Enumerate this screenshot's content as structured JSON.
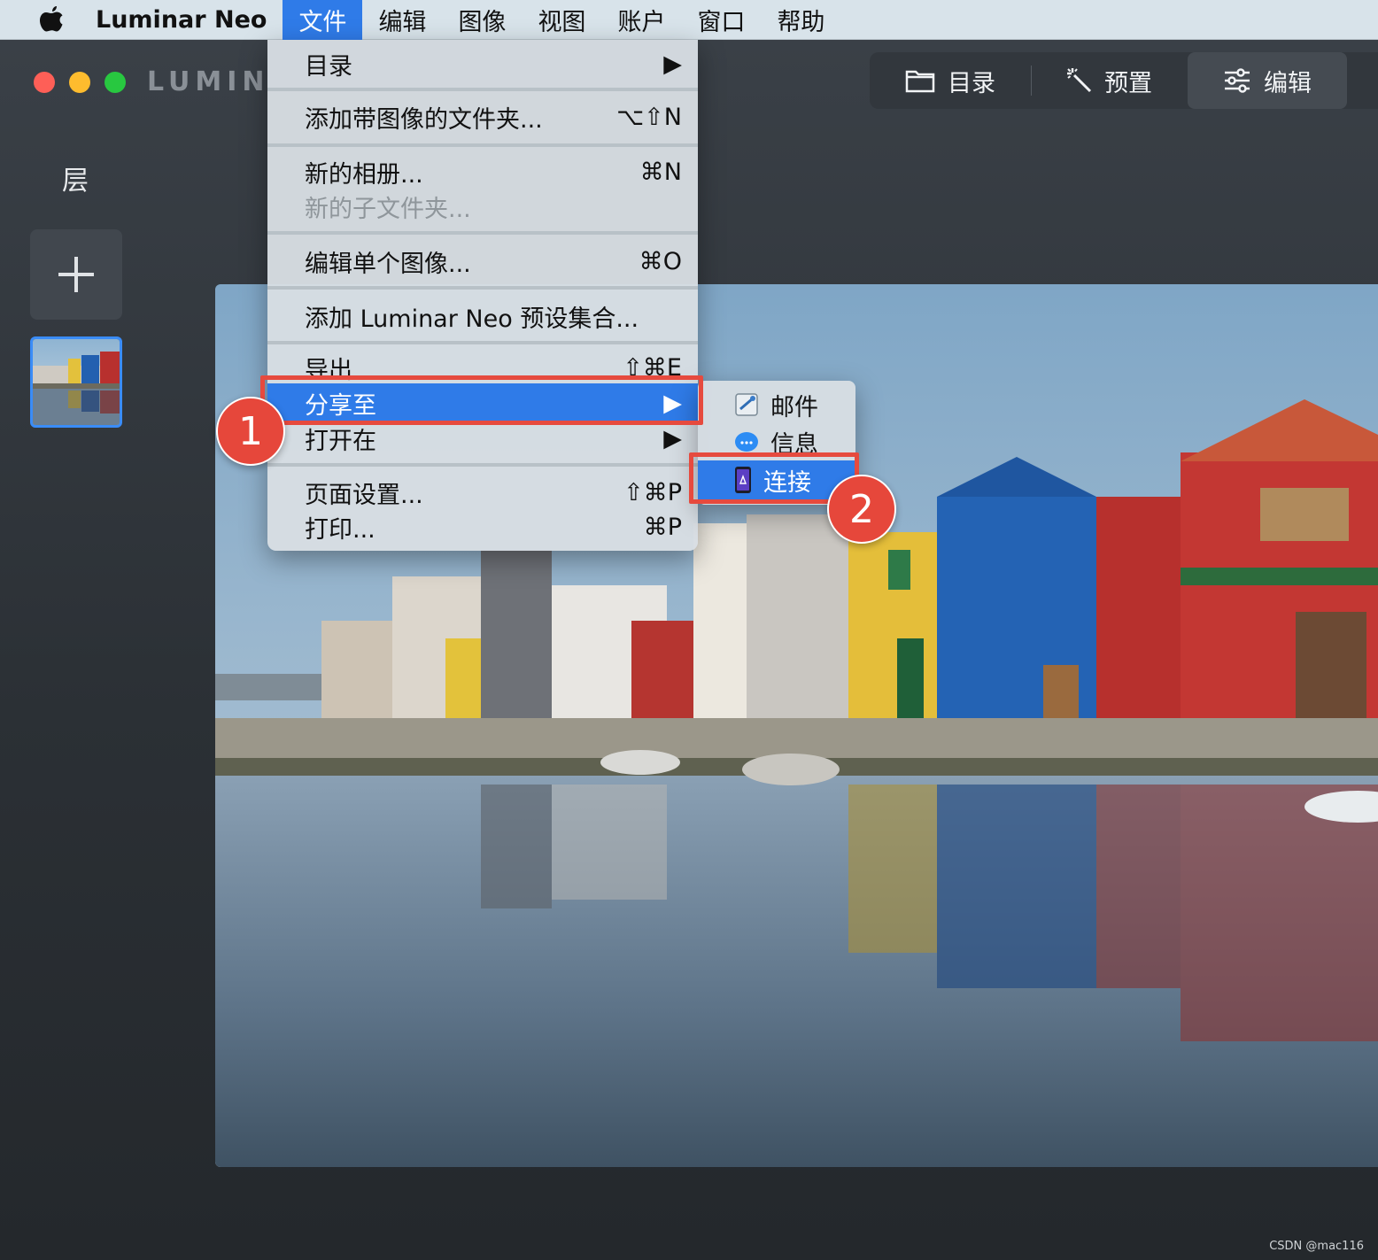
{
  "menubar": {
    "app_name": "Luminar Neo",
    "items": [
      "文件",
      "编辑",
      "图像",
      "视图",
      "账户",
      "窗口",
      "帮助"
    ]
  },
  "window": {
    "brand": "LUMIN",
    "layers_title": "层",
    "top_tabs": [
      {
        "label": "目录",
        "icon": "folder-icon"
      },
      {
        "label": "预置",
        "icon": "magic-wand-icon"
      },
      {
        "label": "编辑",
        "icon": "sliders-icon"
      }
    ]
  },
  "file_menu": {
    "catalog": "目录",
    "add_folder": "添加带图像的文件夹...",
    "add_folder_sc": "⌥⇧N",
    "new_album": "新的相册...",
    "new_album_sc": "⌘N",
    "new_subfolder": "新的子文件夹...",
    "edit_single": "编辑单个图像...",
    "edit_single_sc": "⌘O",
    "add_presets": "添加 Luminar Neo 预设集合...",
    "export": "导出",
    "export_sc": "⇧⌘E",
    "share_to": "分享至",
    "open_in": "打开在",
    "page_setup": "页面设置...",
    "page_setup_sc": "⇧⌘P",
    "print": "打印...",
    "print_sc": "⌘P",
    "arrow": "▶"
  },
  "share_submenu": {
    "mail": "邮件",
    "messages": "信息",
    "connect": "连接"
  },
  "annotations": {
    "badge1": "1",
    "badge2": "2",
    "accent": "#e6473b"
  },
  "watermark": "CSDN @mac116"
}
